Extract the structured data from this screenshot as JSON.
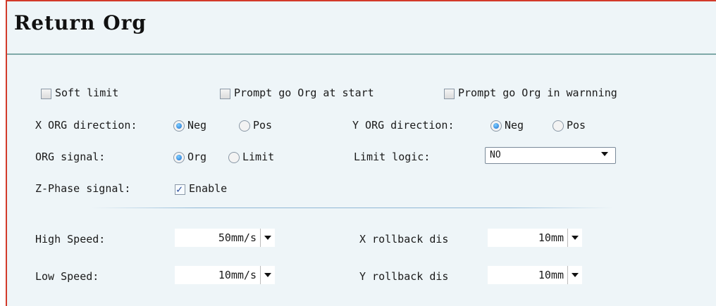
{
  "panel": {
    "title": "Return Org",
    "accent": "#d23a2a",
    "rule_color": "#7fa9a8"
  },
  "options": {
    "soft_limit": {
      "label": "Soft limit",
      "checked": false
    },
    "prompt_start": {
      "label": "Prompt go Org at start",
      "checked": false
    },
    "prompt_warning": {
      "label": "Prompt go Org in warnning",
      "checked": false
    }
  },
  "x_org": {
    "label": "X ORG direction:",
    "neg": "Neg",
    "pos": "Pos",
    "selected": "Neg"
  },
  "y_org": {
    "label": "Y ORG direction:",
    "neg": "Neg",
    "pos": "Pos",
    "selected": "Neg"
  },
  "org_signal": {
    "label": "ORG signal:",
    "org": "Org",
    "limit": "Limit",
    "selected": "Org"
  },
  "limit_logic": {
    "label": "Limit logic:",
    "value": "NO"
  },
  "z_phase": {
    "label": "Z-Phase signal:",
    "enable": "Enable",
    "checked": true
  },
  "high_speed": {
    "label": "High Speed:",
    "value": "50mm/s"
  },
  "low_speed": {
    "label": "Low Speed:",
    "value": "10mm/s"
  },
  "x_rollback": {
    "label": "X rollback dis",
    "value": "10mm"
  },
  "y_rollback": {
    "label": "Y rollback dis",
    "value": "10mm"
  }
}
